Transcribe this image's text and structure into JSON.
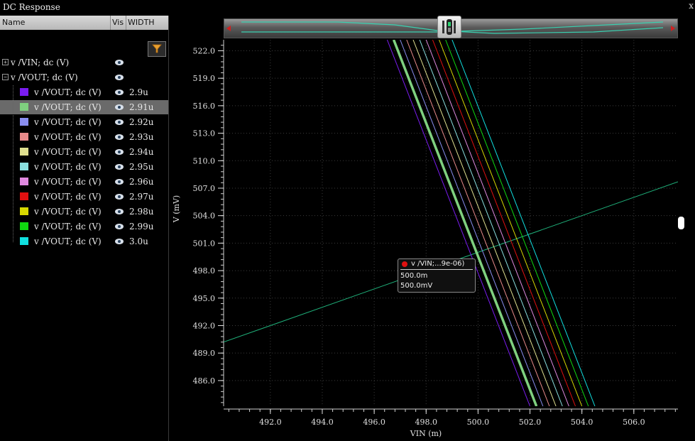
{
  "window": {
    "title": "DC Response",
    "close_label": "x"
  },
  "panel": {
    "columns": {
      "name": "Name",
      "vis": "Vis",
      "width": "WIDTH"
    },
    "parents": [
      {
        "label": "v /VIN; dc (V)",
        "expander": "+"
      },
      {
        "label": "v /VOUT; dc (V)",
        "expander": "−"
      }
    ],
    "children": [
      {
        "label": "v /VOUT; dc (V)",
        "width": "2.9u",
        "color": "#7a1cf0",
        "selected": false
      },
      {
        "label": "v /VOUT; dc (V)",
        "width": "2.91u",
        "color": "#7fd07f",
        "selected": true
      },
      {
        "label": "v /VOUT; dc (V)",
        "width": "2.92u",
        "color": "#8a8ef0",
        "selected": false
      },
      {
        "label": "v /VOUT; dc (V)",
        "width": "2.93u",
        "color": "#e88a8a",
        "selected": false
      },
      {
        "label": "v /VOUT; dc (V)",
        "width": "2.94u",
        "color": "#e0e090",
        "selected": false
      },
      {
        "label": "v /VOUT; dc (V)",
        "width": "2.95u",
        "color": "#8ae0e0",
        "selected": false
      },
      {
        "label": "v /VOUT; dc (V)",
        "width": "2.96u",
        "color": "#e08ae0",
        "selected": false
      },
      {
        "label": "v /VOUT; dc (V)",
        "width": "2.97u",
        "color": "#e01010",
        "selected": false
      },
      {
        "label": "v /VOUT; dc (V)",
        "width": "2.98u",
        "color": "#d8d800",
        "selected": false
      },
      {
        "label": "v /VOUT; dc (V)",
        "width": "2.99u",
        "color": "#10d810",
        "selected": false
      },
      {
        "label": "v /VOUT; dc (V)",
        "width": "3.0u",
        "color": "#10e0e0",
        "selected": false
      }
    ]
  },
  "tooltip": {
    "title": "v /VIN;...9e-06)",
    "x_value": "500.0m",
    "y_value": "500.0mV"
  },
  "chart_data": {
    "type": "line",
    "xlabel": "VIN (m)",
    "ylabel": "V (mV)",
    "xlim": [
      490.2,
      507.7
    ],
    "ylim": [
      483.2,
      523.2
    ],
    "xticks": [
      492.0,
      494.0,
      496.0,
      498.0,
      500.0,
      502.0,
      504.0,
      506.0
    ],
    "yticks": [
      486.0,
      489.0,
      492.0,
      495.0,
      498.0,
      501.0,
      504.0,
      507.0,
      510.0,
      513.0,
      516.0,
      519.0,
      522.0
    ],
    "tick_decimals": 1,
    "grid": true,
    "vin_line": {
      "name": "v /VIN; dc (V)",
      "color": "#1fb07a",
      "x": [
        490.2,
        507.7
      ],
      "y": [
        490.2,
        507.7
      ]
    },
    "series": [
      {
        "name": "v /VOUT; dc (V)",
        "width": "2.9u",
        "color": "#7a1cf0",
        "x": [
          496.5,
          502.0
        ],
        "y": [
          523.2,
          483.2
        ]
      },
      {
        "name": "v /VOUT; dc (V)",
        "width": "2.91u",
        "color": "#7fd07f",
        "x": [
          496.75,
          502.25
        ],
        "y": [
          523.2,
          483.2
        ],
        "highlight": true
      },
      {
        "name": "v /VOUT; dc (V)",
        "width": "2.92u",
        "color": "#8a8ef0",
        "x": [
          497.0,
          502.5
        ],
        "y": [
          523.2,
          483.2
        ]
      },
      {
        "name": "v /VOUT; dc (V)",
        "width": "2.93u",
        "color": "#e88a8a",
        "x": [
          497.25,
          502.75
        ],
        "y": [
          523.2,
          483.2
        ]
      },
      {
        "name": "v /VOUT; dc (V)",
        "width": "2.94u",
        "color": "#e0e090",
        "x": [
          497.5,
          503.0
        ],
        "y": [
          523.2,
          483.2
        ]
      },
      {
        "name": "v /VOUT; dc (V)",
        "width": "2.95u",
        "color": "#8ae0e0",
        "x": [
          497.75,
          503.25
        ],
        "y": [
          523.2,
          483.2
        ]
      },
      {
        "name": "v /VOUT; dc (V)",
        "width": "2.96u",
        "color": "#e08ae0",
        "x": [
          498.0,
          503.5
        ],
        "y": [
          523.2,
          483.2
        ]
      },
      {
        "name": "v /VOUT; dc (V)",
        "width": "2.97u",
        "color": "#e01010",
        "x": [
          498.25,
          503.75
        ],
        "y": [
          523.2,
          483.2
        ]
      },
      {
        "name": "v /VOUT; dc (V)",
        "width": "2.98u",
        "color": "#d8d800",
        "x": [
          498.5,
          504.0
        ],
        "y": [
          523.2,
          483.2
        ]
      },
      {
        "name": "v /VOUT; dc (V)",
        "width": "2.99u",
        "color": "#10d810",
        "x": [
          498.75,
          504.25
        ],
        "y": [
          523.2,
          483.2
        ]
      },
      {
        "name": "v /VOUT; dc (V)",
        "width": "3.0u",
        "color": "#10e0e0",
        "x": [
          499.0,
          504.5
        ],
        "y": [
          523.2,
          483.2
        ]
      }
    ]
  }
}
